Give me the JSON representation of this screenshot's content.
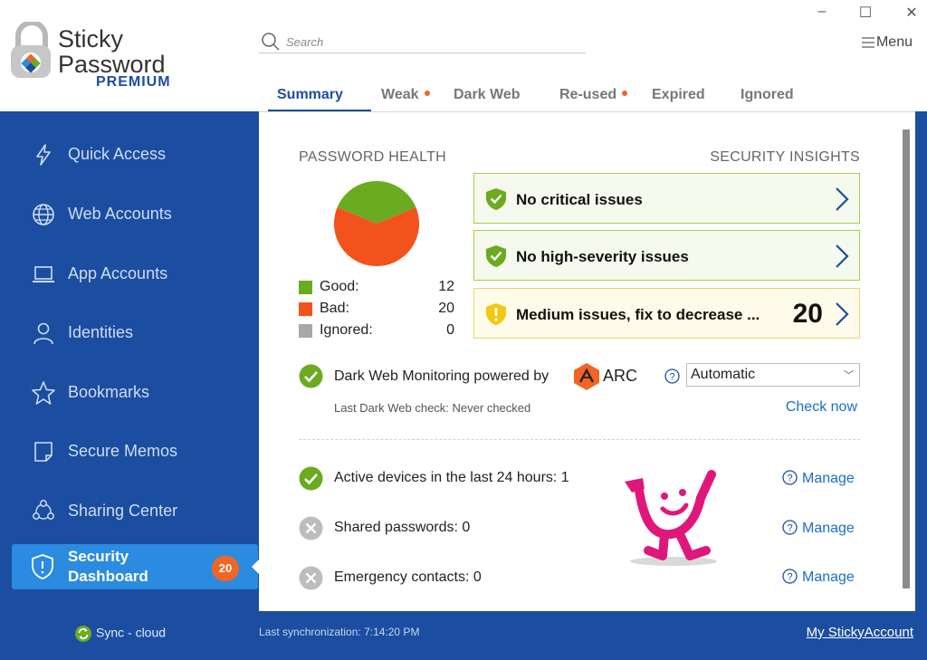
{
  "app": {
    "logo_line1": "Sticky",
    "logo_line2": "Password",
    "logo_edition": "PREMIUM"
  },
  "search": {
    "placeholder": "Search"
  },
  "window": {
    "menu_label": "Menu"
  },
  "tabs": [
    {
      "label": "Summary",
      "active": true,
      "dot": false
    },
    {
      "label": "Weak",
      "active": false,
      "dot": true
    },
    {
      "label": "Dark Web",
      "active": false,
      "dot": false
    },
    {
      "label": "Re-used",
      "active": false,
      "dot": true
    },
    {
      "label": "Expired",
      "active": false,
      "dot": false
    },
    {
      "label": "Ignored",
      "active": false,
      "dot": false
    }
  ],
  "sidebar": {
    "items": [
      {
        "label": "Quick Access",
        "icon": "lightning-icon"
      },
      {
        "label": "Web Accounts",
        "icon": "globe-icon"
      },
      {
        "label": "App Accounts",
        "icon": "laptop-icon"
      },
      {
        "label": "Identities",
        "icon": "person-icon"
      },
      {
        "label": "Bookmarks",
        "icon": "star-icon"
      },
      {
        "label": "Secure Memos",
        "icon": "memo-icon"
      },
      {
        "label": "Sharing Center",
        "icon": "share-icon"
      }
    ],
    "active_item": {
      "label": "Security Dashboard",
      "icon": "shield-icon",
      "badge": "20"
    },
    "sync_label": "Sync - cloud"
  },
  "password_health": {
    "heading": "PASSWORD HEALTH",
    "legend": [
      {
        "label": "Good:",
        "value": "12",
        "color": "#6aab1f"
      },
      {
        "label": "Bad:",
        "value": "20",
        "color": "#f2531c"
      },
      {
        "label": "Ignored:",
        "value": "0",
        "color": "#a8a8a8"
      }
    ]
  },
  "security_insights": {
    "heading": "SECURITY INSIGHTS",
    "items": [
      {
        "text": "No critical issues",
        "severity": "ok"
      },
      {
        "text": "No high-severity issues",
        "severity": "ok"
      },
      {
        "text": "Medium issues, fix to decrease ...",
        "count": "20",
        "severity": "medium"
      }
    ]
  },
  "dark_web": {
    "label": "Dark Web Monitoring powered by",
    "provider": "ARC",
    "mode": "Automatic",
    "last_check": "Last Dark Web check: Never checked",
    "check_now": "Check now"
  },
  "status_rows": [
    {
      "text": "Active devices in the last 24 hours: 1",
      "state": "ok",
      "action": "Manage"
    },
    {
      "text": "Shared passwords: 0",
      "state": "none",
      "action": "Manage"
    },
    {
      "text": "Emergency contacts: 0",
      "state": "none",
      "action": "Manage"
    }
  ],
  "footer": {
    "last_sync": "Last synchronization: 7:14:20 PM",
    "account_link": "My StickyAccount"
  },
  "colors": {
    "sidebar_bg": "#1b4ea0",
    "active_item": "#2b8be0",
    "accent_orange": "#f26522",
    "ok_green": "#6aab1f",
    "link_blue": "#1b6ec8"
  }
}
